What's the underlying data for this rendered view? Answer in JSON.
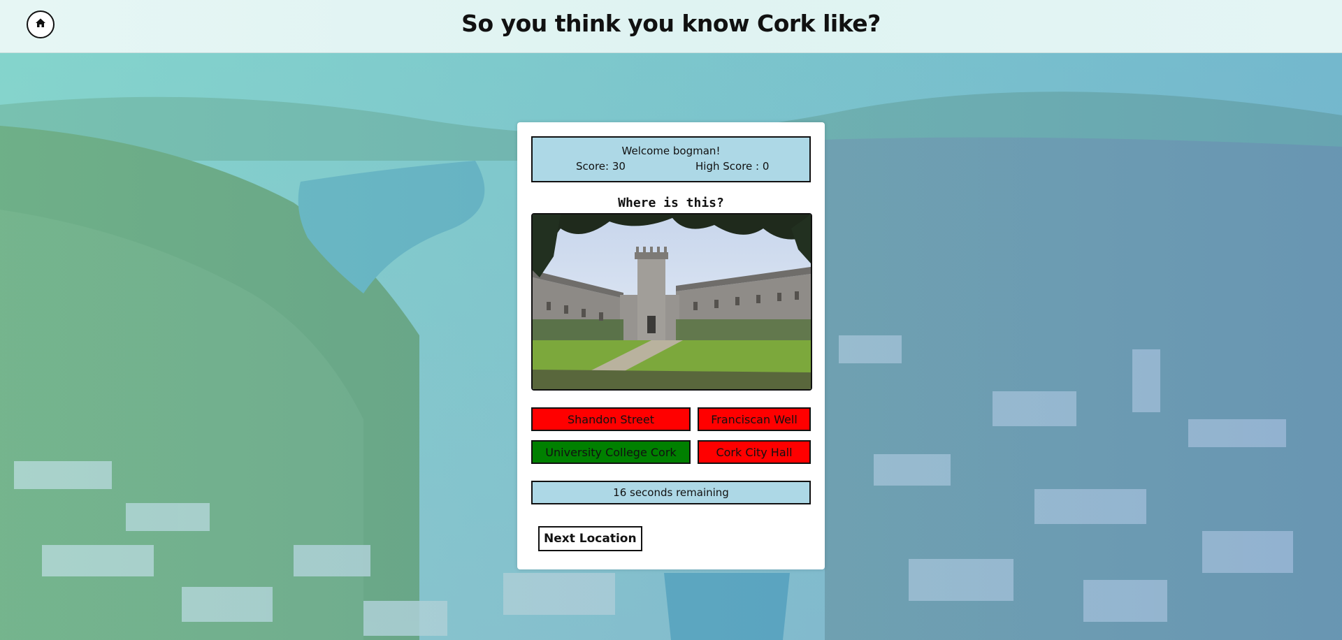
{
  "header": {
    "title": "So you think you know Cork like?",
    "home_icon": "home-icon"
  },
  "quiz": {
    "welcome": "Welcome bogman!",
    "score": "Score: 30",
    "high_score": "High Score : 0",
    "question": "Where is this?",
    "answers": [
      {
        "label": "Shandon Street",
        "state": "wrong",
        "color": "#ff0000"
      },
      {
        "label": "Franciscan Well",
        "state": "wrong",
        "color": "#ff0000"
      },
      {
        "label": "University College Cork",
        "state": "correct",
        "color": "#008000"
      },
      {
        "label": "Cork City Hall",
        "state": "wrong",
        "color": "#ff0000"
      }
    ],
    "timer": "16 seconds remaining",
    "next_label": "Next Location"
  },
  "colors": {
    "info_box": "#add8e6",
    "correct": "#008000",
    "wrong": "#ff0000",
    "background_tint": "#8fd3cf"
  }
}
